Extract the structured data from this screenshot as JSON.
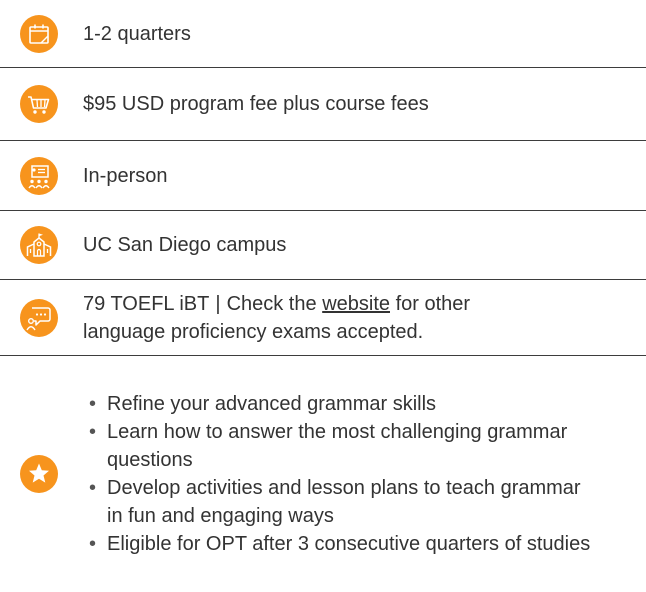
{
  "theme": {
    "accent": "#f7941d",
    "text": "#333333",
    "divider": "#3d3d3d"
  },
  "items": [
    {
      "icon": "calendar-icon",
      "text": "1-2 quarters"
    },
    {
      "icon": "shopping-cart-icon",
      "text": "$95 USD program fee plus course fees"
    },
    {
      "icon": "classroom-presentation-icon",
      "text": "In-person"
    },
    {
      "icon": "campus-building-icon",
      "text": "UC San Diego campus"
    },
    {
      "icon": "chat-bubble-icon",
      "text_before": "79 TOEFL iBT",
      "separator": "|",
      "text_check": "Check the",
      "link": "website",
      "text_after": "for other language proficiency exams accepted."
    }
  ],
  "highlights": {
    "icon": "star-icon",
    "bullets": [
      "Refine your advanced grammar skills",
      "Learn how to answer the most challenging grammar questions",
      "Develop activities and lesson plans to teach grammar in fun and engaging ways",
      "Eligible for OPT after 3 consecutive quarters of studies"
    ]
  }
}
